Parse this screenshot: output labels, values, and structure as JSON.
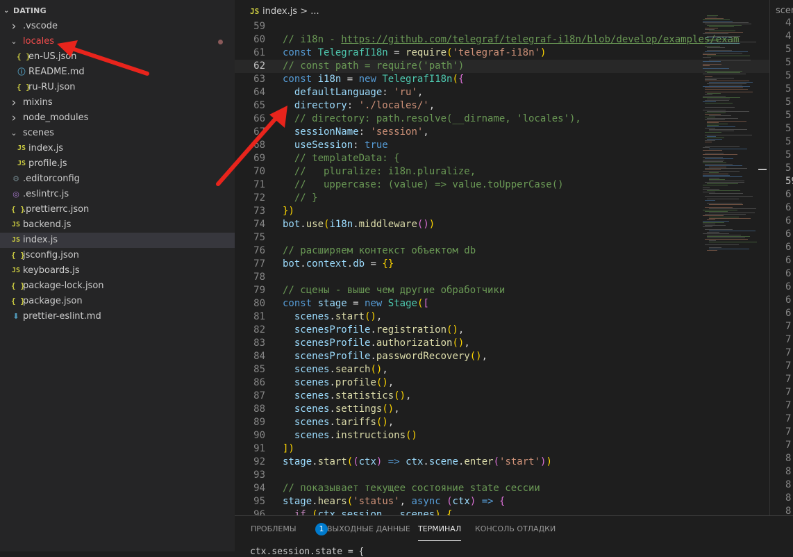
{
  "explorer": {
    "root_label": "DATING",
    "items": [
      {
        "label": ".vscode",
        "type": "folder",
        "open": false,
        "depth": 0,
        "icon": "chevron-right-icon"
      },
      {
        "label": "locales",
        "type": "folder",
        "open": true,
        "depth": 0,
        "icon": "chevron-down-icon",
        "modified": true,
        "color": "#f14c4c"
      },
      {
        "label": "en-US.json",
        "type": "json",
        "depth": 1,
        "icon": "json-file-icon"
      },
      {
        "label": "README.md",
        "type": "info",
        "depth": 1,
        "icon": "info-icon"
      },
      {
        "label": "ru-RU.json",
        "type": "json",
        "depth": 1,
        "icon": "json-file-icon"
      },
      {
        "label": "mixins",
        "type": "folder",
        "open": false,
        "depth": 0,
        "icon": "chevron-right-icon"
      },
      {
        "label": "node_modules",
        "type": "folder",
        "open": false,
        "depth": 0,
        "icon": "chevron-right-icon"
      },
      {
        "label": "scenes",
        "type": "folder",
        "open": true,
        "depth": 0,
        "icon": "chevron-down-icon"
      },
      {
        "label": "index.js",
        "type": "js",
        "depth": 1,
        "icon": "js-file-icon"
      },
      {
        "label": "profile.js",
        "type": "js",
        "depth": 1,
        "icon": "js-file-icon"
      },
      {
        "label": ".editorconfig",
        "type": "gear",
        "depth": 0,
        "icon": "gear-icon"
      },
      {
        "label": ".eslintrc.js",
        "type": "eslint",
        "depth": 0,
        "icon": "eslint-icon"
      },
      {
        "label": ".prettierrc.json",
        "type": "json",
        "depth": 0,
        "icon": "json-file-icon"
      },
      {
        "label": "backend.js",
        "type": "js",
        "depth": 0,
        "icon": "js-file-icon"
      },
      {
        "label": "index.js",
        "type": "js",
        "depth": 0,
        "icon": "js-file-icon",
        "selected": true
      },
      {
        "label": "jsconfig.json",
        "type": "json",
        "depth": 0,
        "icon": "json-file-icon"
      },
      {
        "label": "keyboards.js",
        "type": "js",
        "depth": 0,
        "icon": "js-file-icon"
      },
      {
        "label": "package-lock.json",
        "type": "json",
        "depth": 0,
        "icon": "json-file-icon"
      },
      {
        "label": "package.json",
        "type": "json",
        "depth": 0,
        "icon": "json-file-icon"
      },
      {
        "label": "prettier-eslint.md",
        "type": "md",
        "depth": 0,
        "icon": "download-arrow-icon"
      }
    ]
  },
  "editor": {
    "breadcrumb_icon": "JS",
    "breadcrumb_file": "index.js",
    "breadcrumb_sep": " > ...",
    "current_line": 62,
    "lines": [
      {
        "n": 59,
        "code": ""
      },
      {
        "n": 60,
        "code": "    // i18n - https://github.com/telegraf/telegraf-i18n/blob/develop/examples/exam"
      },
      {
        "n": 61,
        "code": "    const TelegrafI18n = require('telegraf-i18n')"
      },
      {
        "n": 62,
        "code": "    // const path = require('path')"
      },
      {
        "n": 63,
        "code": "    const i18n = new TelegrafI18n({"
      },
      {
        "n": 64,
        "code": "      defaultLanguage: 'ru',"
      },
      {
        "n": 65,
        "code": "      directory: './locales/',"
      },
      {
        "n": 66,
        "code": "      // directory: path.resolve(__dirname, 'locales'),"
      },
      {
        "n": 67,
        "code": "      sessionName: 'session',"
      },
      {
        "n": 68,
        "code": "      useSession: true"
      },
      {
        "n": 69,
        "code": "      // templateData: {"
      },
      {
        "n": 70,
        "code": "      //   pluralize: i18n.pluralize,"
      },
      {
        "n": 71,
        "code": "      //   uppercase: (value) => value.toUpperCase()"
      },
      {
        "n": 72,
        "code": "      // }"
      },
      {
        "n": 73,
        "code": "    })"
      },
      {
        "n": 74,
        "code": "    bot.use(i18n.middleware())"
      },
      {
        "n": 75,
        "code": ""
      },
      {
        "n": 76,
        "code": "    // расширяем контекст объектом db"
      },
      {
        "n": 77,
        "code": "    bot.context.db = {}"
      },
      {
        "n": 78,
        "code": ""
      },
      {
        "n": 79,
        "code": "    // сцены - выше чем другие обработчики"
      },
      {
        "n": 80,
        "code": "    const stage = new Stage(["
      },
      {
        "n": 81,
        "code": "      scenes.start(),"
      },
      {
        "n": 82,
        "code": "      scenesProfile.registration(),"
      },
      {
        "n": 83,
        "code": "      scenesProfile.authorization(),"
      },
      {
        "n": 84,
        "code": "      scenesProfile.passwordRecovery(),"
      },
      {
        "n": 85,
        "code": "      scenes.search(),"
      },
      {
        "n": 86,
        "code": "      scenes.profile(),"
      },
      {
        "n": 87,
        "code": "      scenes.statistics(),"
      },
      {
        "n": 88,
        "code": "      scenes.settings(),"
      },
      {
        "n": 89,
        "code": "      scenes.tariffs(),"
      },
      {
        "n": 90,
        "code": "      scenes.instructions()"
      },
      {
        "n": 91,
        "code": "    ])"
      },
      {
        "n": 92,
        "code": "    stage.start((ctx) => ctx.scene.enter('start'))"
      },
      {
        "n": 93,
        "code": ""
      },
      {
        "n": 94,
        "code": "    // показывает текущее состояние state сессии"
      },
      {
        "n": 95,
        "code": "    stage.hears('status', async (ctx) => {"
      },
      {
        "n": 96,
        "code": "      if (ctx.session.__scenes) {"
      }
    ]
  },
  "right_pane": {
    "tab_label": "scen",
    "line_numbers": [
      "4",
      "4",
      "5",
      "5",
      "5",
      "5",
      "5",
      "5",
      "5",
      "5",
      "5",
      "5",
      "59",
      "6",
      "6",
      "6",
      "6",
      "6",
      "6",
      "6",
      "6",
      "6",
      "6",
      "7",
      "7",
      "7",
      "7",
      "7",
      "7",
      "7",
      "7",
      "7",
      "7",
      "8",
      "8",
      "8",
      "8",
      "8",
      "8"
    ]
  },
  "panel": {
    "tabs": [
      {
        "label": "ПРОБЛЕМЫ",
        "badge": "1"
      },
      {
        "label": "ВЫХОДНЫЕ ДАННЫЕ"
      },
      {
        "label": "ТЕРМИНАЛ",
        "active": true
      },
      {
        "label": "КОНСОЛЬ ОТЛАДКИ"
      }
    ],
    "terminal_text": "ctx.session.state = {"
  },
  "colors": {
    "annotation_arrow": "#e8241c",
    "accent": "#007acc"
  }
}
